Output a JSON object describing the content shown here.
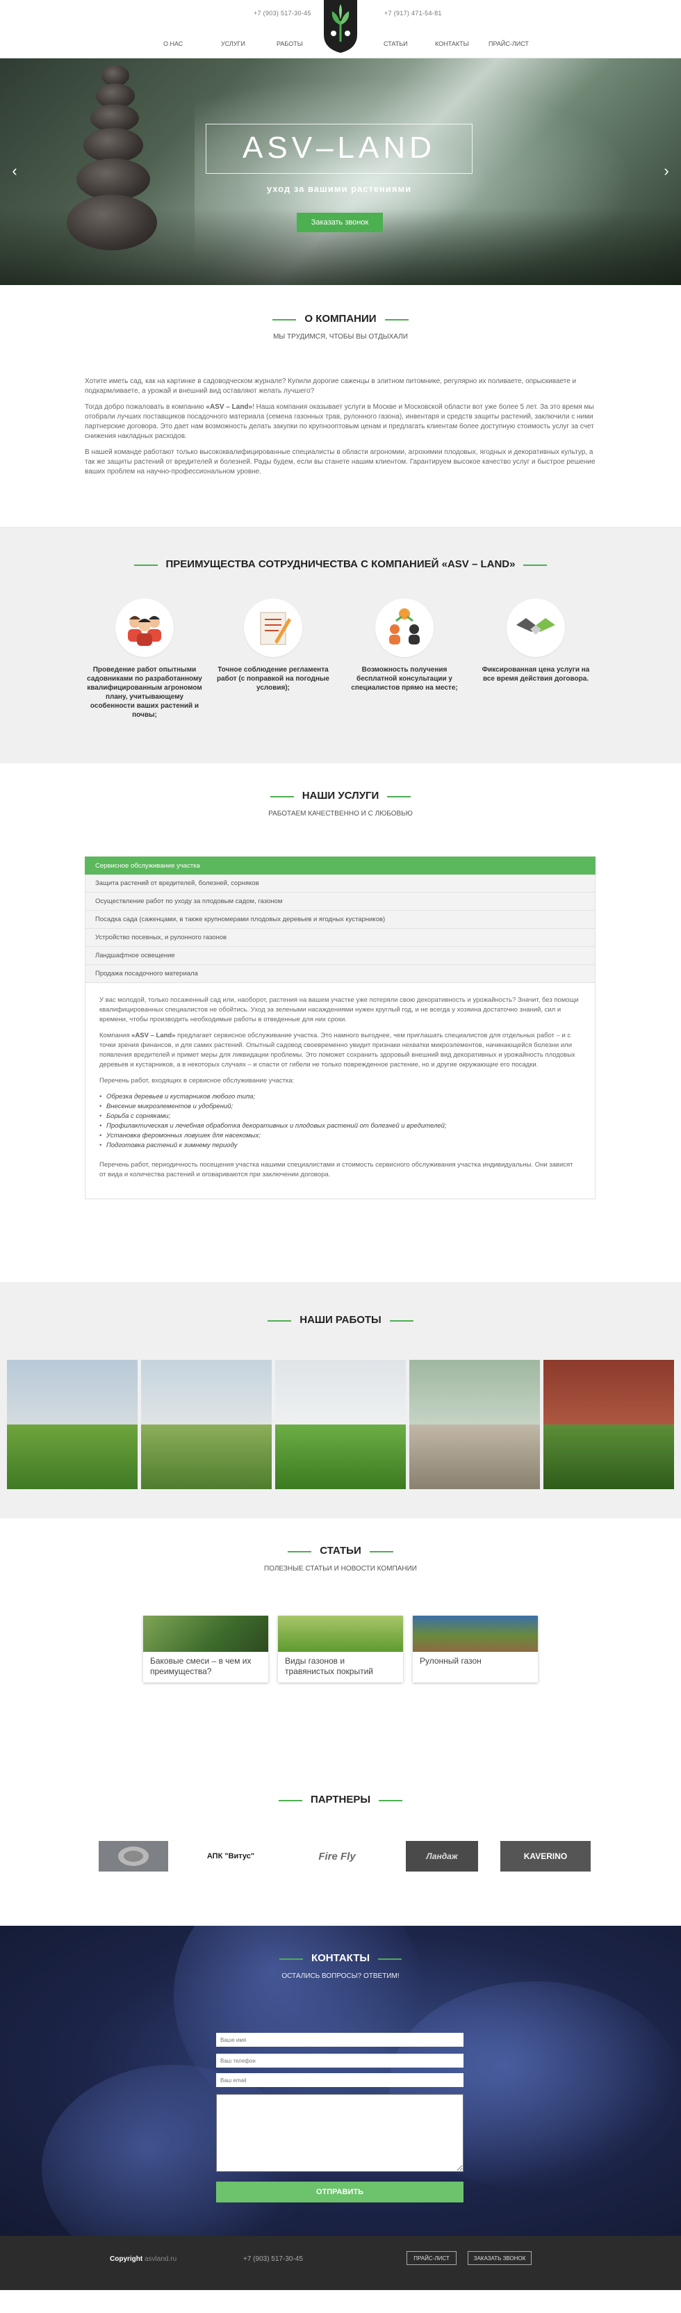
{
  "header": {
    "phone_left": "+7 (903) 517-30-45",
    "phone_right": "+7 (917) 471-54-81",
    "nav": [
      "О НАС",
      "УСЛУГИ",
      "РАБОТЫ",
      "СТАТЬИ",
      "КОНТАКТЫ",
      "ПРАЙС-ЛИСТ"
    ]
  },
  "hero": {
    "title": "ASV–LAND",
    "subtitle": "уход за вашими растениями",
    "button": "Заказать звонок",
    "prev_icon": "‹",
    "next_icon": "›"
  },
  "about": {
    "title": "О КОМПАНИИ",
    "subtitle": "МЫ ТРУДИМСЯ, ЧТОБЫ ВЫ ОТДЫХАЛИ",
    "p1": "Хотите иметь сад, как на картинке в садоводческом журнале? Купили дорогие саженцы в элитном питомнике, регулярно их поливаете, опрыскиваете и подкармливаете, а урожай и внешний вид оставляют желать лучшего?",
    "p2_before": "Тогда добро пожаловать в компанию ",
    "p2_brand": "«ASV – Land»",
    "p2_after": "! Наша компания оказывает услуги в Москве и Московской области вот уже более 5 лет. За это время мы отобрали лучших поставщиков посадочного материала (семена газонных трав, рулонного газона), инвентаря и средств защиты растений, заключили с ними партнерские договора. Это дает нам возможность делать закупки по крупнооптовым ценам и предлагать клиентам более доступную стоимость услуг за счет снижения накладных расходов.",
    "p3": "В нашей команде работают только высококвалифицированные специалисты в области агрономии, агрохимии плодовых, ягодных и декоративных культур, а так же защиты растений от вредителей и болезней. Рады будем, если вы станете нашим клиентом. Гарантируем высокое качество услуг и быстрое решение ваших проблем на научно-профессиональном уровне."
  },
  "advantages": {
    "title": "ПРЕИМУЩЕСТВА СОТРУДНИЧЕСТВА С КОМПАНИЕЙ «ASV – LAND»",
    "items": [
      {
        "text": "Проведение работ опытными садовниками по разработанному квалифицированным агрономом плану, учитывающему особенности ваших растений и почвы;",
        "icon": "team-icon"
      },
      {
        "text": "Точное соблюдение регламента работ (с поправкой на погодные условия);",
        "icon": "checklist-icon"
      },
      {
        "text": "Возможность получения бесплатной консультации у специалистов прямо на месте;",
        "icon": "consultation-icon"
      },
      {
        "text": "Фиксированная цена услуги на все время действия договора.",
        "icon": "handshake-icon"
      }
    ]
  },
  "services": {
    "title": "НАШИ УСЛУГИ",
    "subtitle": "РАБОТАЕМ КАЧЕСТВЕННО И С ЛЮБОВЬЮ",
    "tabs": [
      "Сервисное обслуживание участка",
      "Защита растений от вредителей, болезней, сорняков",
      "Осуществление работ по уходу за плодовым садом, газоном",
      "Посадка сада (саженцами, в также крупномерами плодовых деревьев и ягодных кустарников)",
      "Устройство посевных, и рулонного газонов",
      "Ландшафтное освещение",
      "Продажа посадочного материала"
    ],
    "body_p1": "У вас молодой, только посаженный сад или, наоборот, растения на вашем участке уже потеряли свою декоративность и урожайность? Значит, без помощи квалифицированных специалистов не обойтись. Уход за зелеными насаждениями нужен круглый год, и не всегда у хозяина достаточно знаний, сил и времени, чтобы производить необходимые работы в отведенные для них сроки.",
    "body_p2_before": "Компания ",
    "body_p2_brand": "«ASV – Land»",
    "body_p2_after": " предлагает сервисное обслуживание участка. Это намного выгоднее, чем приглашать специалистов для отдельных работ – и с точки зрения финансов, и для самих растений. Опытный садовод своевременно увидит признаки нехватки микроэлементов, начинающейся болезни или появления вредителей и примет меры для ликвидации проблемы. Это поможет сохранить здоровый внешний вид декоративных и урожайность плодовых деревьев и кустарников, а в некоторых случаях – и спасти от гибели не только поврежденное растение, но и другие окружающие его посадки.",
    "body_p3": "Перечень работ, входящих в сервисное обслуживание участка:",
    "list": [
      "Обрезка деревьев и кустарников любого типа;",
      "Внесение микроэлементов и удобрений;",
      "Борьба с сорняками;",
      "Профилактическая и лечебная обработка декоративных и плодовых растений от болезней и вредителей;",
      "Установка феромонных ловушек для насекомых;",
      "Подготовка растений к зимнему периоду"
    ],
    "body_p4": "Перечень работ, периодичность посещения участка нашими специалистами и стоимость сервисного обслуживания участка индивидуальны. Они зависят от вида и количества растений и оговариваются при заключении договора."
  },
  "works": {
    "title": "НАШИ РАБОТЫ"
  },
  "articles": {
    "title": "СТАТЬИ",
    "subtitle": "ПОЛЕЗНЫЕ СТАТЬИ И НОВОСТИ КОМПАНИИ",
    "items": [
      "Баковые смеси – в чем их преимущества?",
      "Виды газонов и травянистых покрытий",
      "Рулонный газон"
    ]
  },
  "partners": {
    "title": "ПАРТНЕРЫ",
    "items": [
      "",
      "АПК \"Витус\"",
      "Fire Fly",
      "Ландаж",
      "KAVERINO"
    ]
  },
  "contacts": {
    "title": "КОНТАКТЫ",
    "subtitle": "ОСТАЛИСЬ ВОПРОСЫ? ОТВЕТИМ!",
    "name_placeholder": "Ваше имя",
    "phone_placeholder": "Ваш телефон",
    "email_placeholder": "Ваш email",
    "submit": "ОТПРАВИТЬ"
  },
  "footer": {
    "copyright_label": "Copyright",
    "copyright_site": "asvland.ru",
    "phone": "+7 (903) 517-30-45",
    "price_button": "ПРАЙС-ЛИСТ",
    "call_button": "ЗАКАЗАТЬ ЗВОНОК"
  },
  "colors": {
    "accent": "#4caf50",
    "footer_bg": "#2c2c2c",
    "section_gray": "#f0f0f0"
  }
}
